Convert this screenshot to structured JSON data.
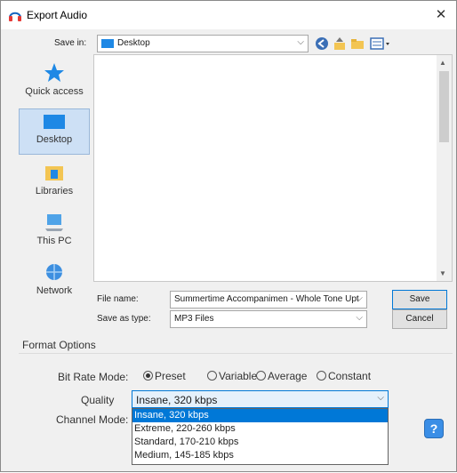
{
  "window": {
    "title": "Export Audio"
  },
  "top": {
    "save_in_label": "Save in:",
    "save_in_value": "Desktop"
  },
  "places": [
    {
      "label": "Quick access"
    },
    {
      "label": "Desktop"
    },
    {
      "label": "Libraries"
    },
    {
      "label": "This PC"
    },
    {
      "label": "Network"
    }
  ],
  "fields": {
    "file_name_label": "File name:",
    "file_name_value": "Summertime Accompanimen - Whole Tone Upt",
    "save_as_type_label": "Save as type:",
    "save_as_type_value": "MP3 Files"
  },
  "buttons": {
    "save": "Save",
    "cancel": "Cancel",
    "help": "?"
  },
  "format": {
    "title": "Format Options",
    "bit_rate_label": "Bit Rate Mode:",
    "modes": [
      "Preset",
      "Variable",
      "Average",
      "Constant"
    ],
    "selected_mode": "Preset",
    "quality_label": "Quality",
    "quality_value": "Insane, 320 kbps",
    "channel_label": "Channel Mode:",
    "quality_options": [
      "Insane, 320 kbps",
      "Extreme, 220-260 kbps",
      "Standard, 170-210 kbps",
      "Medium, 145-185 kbps"
    ]
  },
  "icons": [
    "audacity-icon",
    "close-icon",
    "folder-icon",
    "back-icon",
    "up-folder-icon",
    "new-folder-icon",
    "view-menu-icon",
    "star-icon",
    "desktop-icon",
    "libraries-icon",
    "computer-icon",
    "network-icon",
    "help-icon"
  ],
  "colors": {
    "accent": "#0078d7",
    "selection_bg": "#cde0f5",
    "dialog_bg": "#f0f0f0"
  }
}
